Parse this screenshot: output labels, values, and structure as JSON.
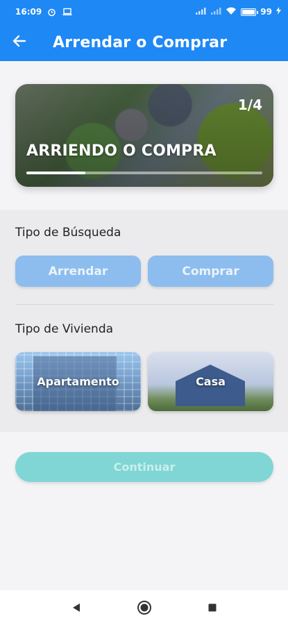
{
  "status_bar": {
    "time": "16:09",
    "battery_text": "99",
    "icons": [
      "alarm-icon",
      "laptop-icon",
      "signal-icon",
      "signal-icon",
      "wifi-icon",
      "battery-icon",
      "charging-icon"
    ]
  },
  "app_bar": {
    "title": "Arrendar o Comprar",
    "back_icon": "arrow-left-icon"
  },
  "hero": {
    "title": "ARRIENDO O COMPRA",
    "counter": "1/4",
    "progress": 0.25
  },
  "search_type": {
    "label": "Tipo de Búsqueda",
    "options": [
      {
        "label": "Arrendar"
      },
      {
        "label": "Comprar"
      }
    ]
  },
  "housing_type": {
    "label": "Tipo de Vivienda",
    "options": [
      {
        "label": "Apartamento"
      },
      {
        "label": "Casa"
      }
    ]
  },
  "continue": {
    "label": "Continuar"
  },
  "nav_bar": {
    "icons": [
      "back-triangle-icon",
      "home-circle-icon",
      "recents-square-icon"
    ]
  },
  "colors": {
    "primary": "#1e88f5",
    "option_button": "#8cbdee",
    "continue_button": "#80d6d4"
  }
}
